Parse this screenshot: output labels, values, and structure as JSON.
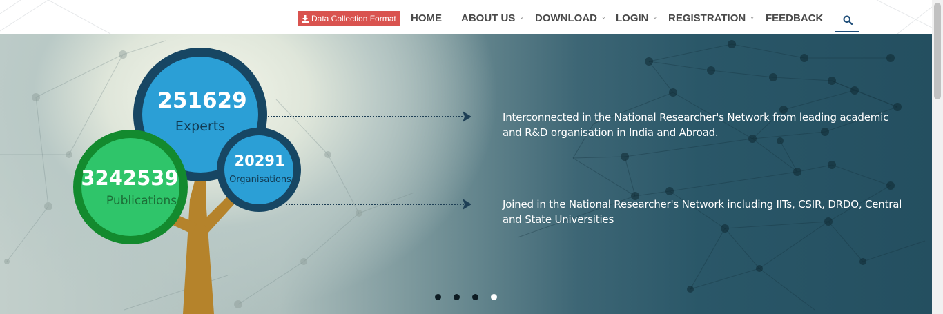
{
  "header": {
    "data_collection_label": "Data Collection Format",
    "nav": [
      {
        "label": "HOME",
        "has_dropdown": false
      },
      {
        "label": "ABOUT US",
        "has_dropdown": true
      },
      {
        "label": "DOWNLOAD",
        "has_dropdown": true
      },
      {
        "label": "LOGIN",
        "has_dropdown": true
      },
      {
        "label": "REGISTRATION",
        "has_dropdown": true
      },
      {
        "label": "FEEDBACK",
        "has_dropdown": false
      }
    ],
    "search_icon": "search-icon"
  },
  "hero": {
    "experts": {
      "value": "251629",
      "label": "Experts"
    },
    "publications": {
      "value": "3242539",
      "label": "Publications"
    },
    "organisations": {
      "value": "20291",
      "label": "Organisations"
    },
    "statements": [
      "Interconnected in the National Researcher's Network from leading academic and R&D organisation in India and Abroad.",
      "Joined in the National Researcher's Network including IITs, CSIR, DRDO, Central and State Universities"
    ],
    "slides": {
      "count": 4,
      "active": 4
    }
  },
  "colors": {
    "accent_red": "#d9534f",
    "experts_blue": "#2b9fd6",
    "ring_navy": "#174663",
    "publications_green": "#2fc56a",
    "ring_green": "#138a2e",
    "trunk": "#b5832b",
    "nav_text": "#4a4a4a"
  }
}
